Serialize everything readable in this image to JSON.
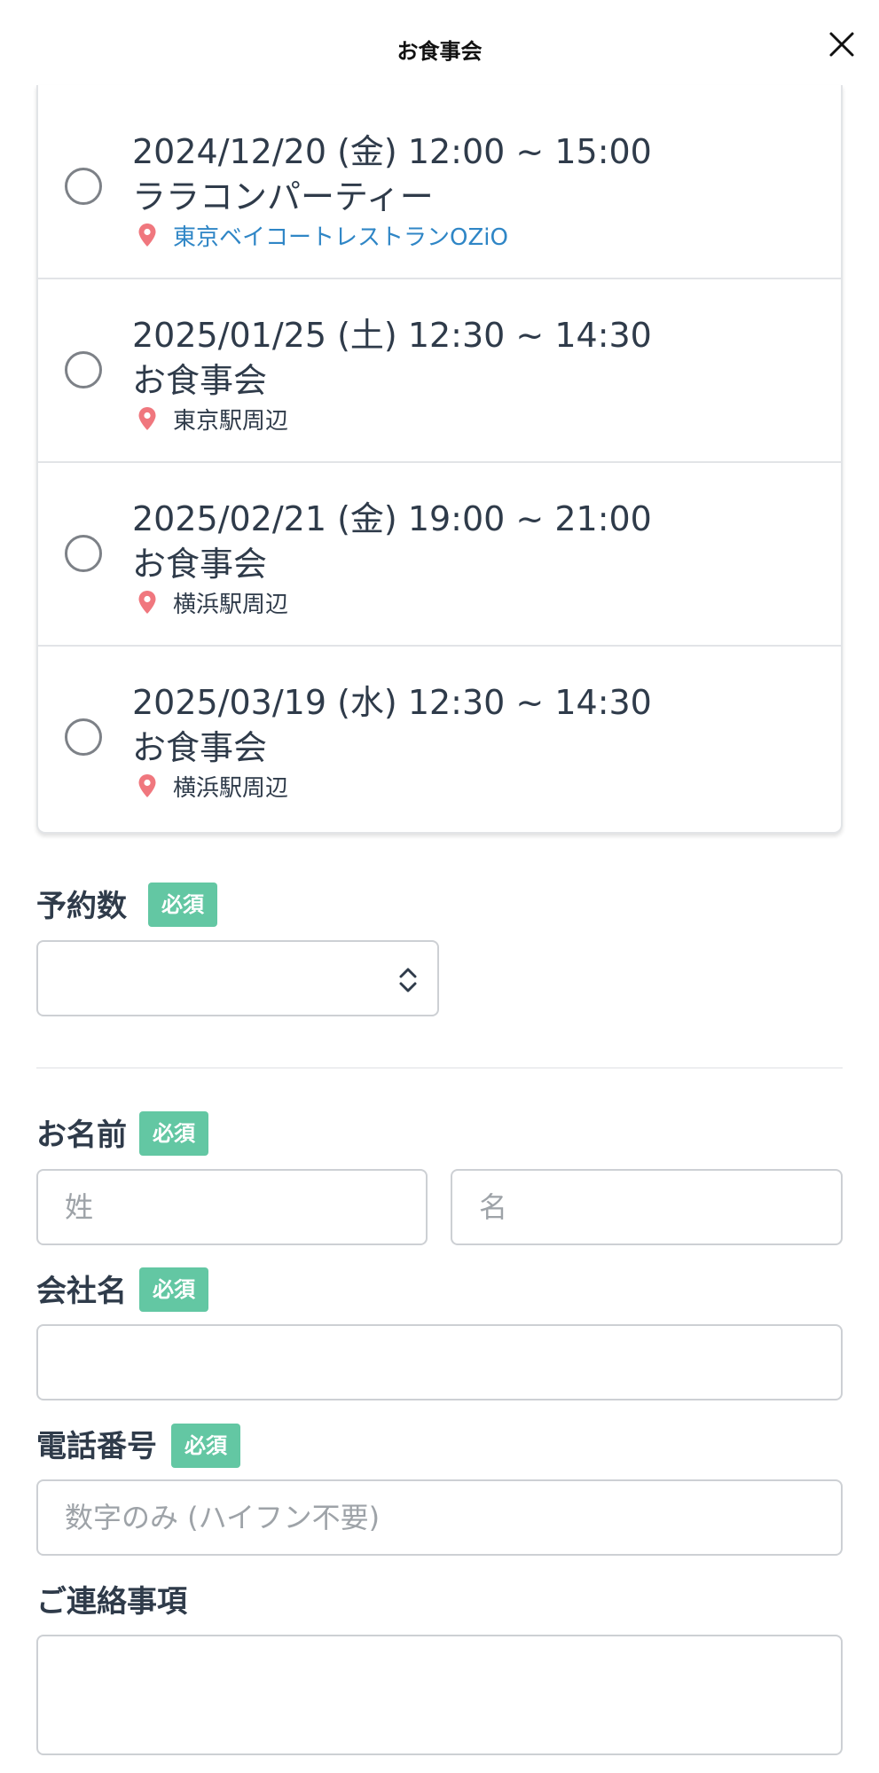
{
  "header": {
    "title": "お食事会"
  },
  "events": [
    {
      "date": "2024/12/20 (金) 12:00 ~ 15:00",
      "name": "ララコンパーティー",
      "place": "東京ベイコートレストランOZiO",
      "place_is_link": true
    },
    {
      "date": "2025/01/25 (土) 12:30 ~ 14:30",
      "name": "お食事会",
      "place": "東京駅周辺",
      "place_is_link": false
    },
    {
      "date": "2025/02/21 (金) 19:00 ~ 21:00",
      "name": "お食事会",
      "place": "横浜駅周辺",
      "place_is_link": false
    },
    {
      "date": "2025/03/19 (水) 12:30 ~ 14:30",
      "name": "お食事会",
      "place": "横浜駅周辺",
      "place_is_link": false
    }
  ],
  "form": {
    "required_badge": "必須",
    "reservation_count": {
      "label": "予約数",
      "value": ""
    },
    "name": {
      "label": "お名前",
      "last_placeholder": "姓",
      "first_placeholder": "名",
      "last_value": "",
      "first_value": ""
    },
    "company": {
      "label": "会社名",
      "value": ""
    },
    "phone": {
      "label": "電話番号",
      "placeholder": "数字のみ (ハイフン不要)",
      "value": ""
    },
    "notes": {
      "label": "ご連絡事項",
      "value": ""
    }
  },
  "colors": {
    "badge": "#63c7a3",
    "pin": "#f0777e",
    "link": "#2f86c6",
    "text": "#2f3b4a"
  }
}
